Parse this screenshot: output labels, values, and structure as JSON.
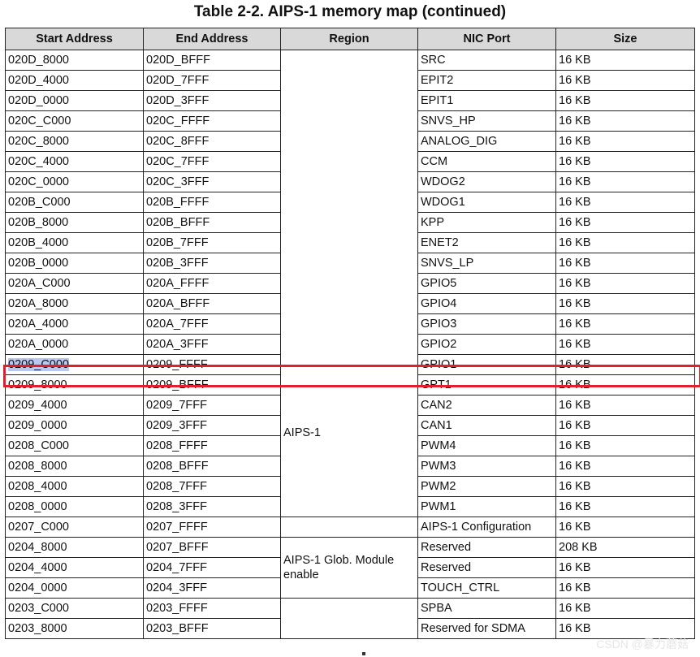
{
  "title": "Table 2-2.   AIPS-1 memory map (continued)",
  "headers": [
    "Start Address",
    "End Address",
    "Region",
    "NIC Port",
    "Size"
  ],
  "rows": [
    {
      "start": "020D_8000",
      "end": "020D_BFFF",
      "port": "SRC",
      "size": "16 KB"
    },
    {
      "start": "020D_4000",
      "end": "020D_7FFF",
      "port": "EPIT2",
      "size": "16 KB"
    },
    {
      "start": "020D_0000",
      "end": "020D_3FFF",
      "port": "EPIT1",
      "size": "16 KB"
    },
    {
      "start": "020C_C000",
      "end": "020C_FFFF",
      "port": "SNVS_HP",
      "size": "16 KB"
    },
    {
      "start": "020C_8000",
      "end": "020C_8FFF",
      "port": "ANALOG_DIG",
      "size": "16 KB"
    },
    {
      "start": "020C_4000",
      "end": "020C_7FFF",
      "port": "CCM",
      "size": "16 KB"
    },
    {
      "start": "020C_0000",
      "end": "020C_3FFF",
      "port": "WDOG2",
      "size": "16 KB"
    },
    {
      "start": "020B_C000",
      "end": "020B_FFFF",
      "port": "WDOG1",
      "size": "16 KB"
    },
    {
      "start": "020B_8000",
      "end": "020B_BFFF",
      "port": "KPP",
      "size": "16 KB"
    },
    {
      "start": "020B_4000",
      "end": "020B_7FFF",
      "port": "ENET2",
      "size": "16 KB"
    },
    {
      "start": "020B_0000",
      "end": "020B_3FFF",
      "port": "SNVS_LP",
      "size": "16 KB"
    },
    {
      "start": "020A_C000",
      "end": "020A_FFFF",
      "port": "GPIO5",
      "size": "16 KB"
    },
    {
      "start": "020A_8000",
      "end": "020A_BFFF",
      "port": "GPIO4",
      "size": "16 KB"
    },
    {
      "start": "020A_4000",
      "end": "020A_7FFF",
      "port": "GPIO3",
      "size": "16 KB"
    },
    {
      "start": "020A_0000",
      "end": "020A_3FFF",
      "port": "GPIO2",
      "size": "16 KB"
    },
    {
      "start": "0209_C000",
      "end": "0209_FFFF",
      "port": "GPIO1",
      "size": "16 KB"
    },
    {
      "start": "0209_8000",
      "end": "0209_BFFF",
      "port": "GPT1",
      "size": "16 KB"
    },
    {
      "start": "0209_4000",
      "end": "0209_7FFF",
      "port": "CAN2",
      "size": "16 KB"
    },
    {
      "start": "0209_0000",
      "end": "0209_3FFF",
      "port": "CAN1",
      "size": "16 KB"
    },
    {
      "start": "0208_C000",
      "end": "0208_FFFF",
      "port": "PWM4",
      "size": "16 KB"
    },
    {
      "start": "0208_8000",
      "end": "0208_BFFF",
      "port": "PWM3",
      "size": "16 KB"
    },
    {
      "start": "0208_4000",
      "end": "0208_7FFF",
      "port": "PWM2",
      "size": "16 KB"
    },
    {
      "start": "0208_0000",
      "end": "0208_3FFF",
      "port": "PWM1",
      "size": "16 KB"
    },
    {
      "start": "0207_C000",
      "end": "0207_FFFF",
      "port": "AIPS-1 Configuration",
      "size": "16 KB"
    },
    {
      "start": "0204_8000",
      "end": "0207_BFFF",
      "port": "Reserved",
      "size": "208 KB"
    },
    {
      "start": "0204_4000",
      "end": "0204_7FFF",
      "port": "Reserved",
      "size": "16 KB"
    },
    {
      "start": "0204_0000",
      "end": "0204_3FFF",
      "port": "TOUCH_CTRL",
      "size": "16 KB"
    },
    {
      "start": "0203_C000",
      "end": "0203_FFFF",
      "port": "SPBA",
      "size": "16 KB"
    },
    {
      "start": "0203_8000",
      "end": "0203_BFFF",
      "port": "Reserved for SDMA",
      "size": "16 KB"
    }
  ],
  "regions": [
    {
      "label": "AIPS-1",
      "rows": 23
    },
    {
      "label": "",
      "rows": 1
    },
    {
      "label": "AIPS-1 Glob. Module enable",
      "rows": 3
    },
    {
      "label": "",
      "rows": 2
    }
  ],
  "highlighted_row_index": 15,
  "colors": {
    "header_bg": "#d9d9d9",
    "highlight_border": "#e0202c",
    "selection": "#b9c8ee"
  },
  "watermark": "CSDN @暴力蘑菇"
}
